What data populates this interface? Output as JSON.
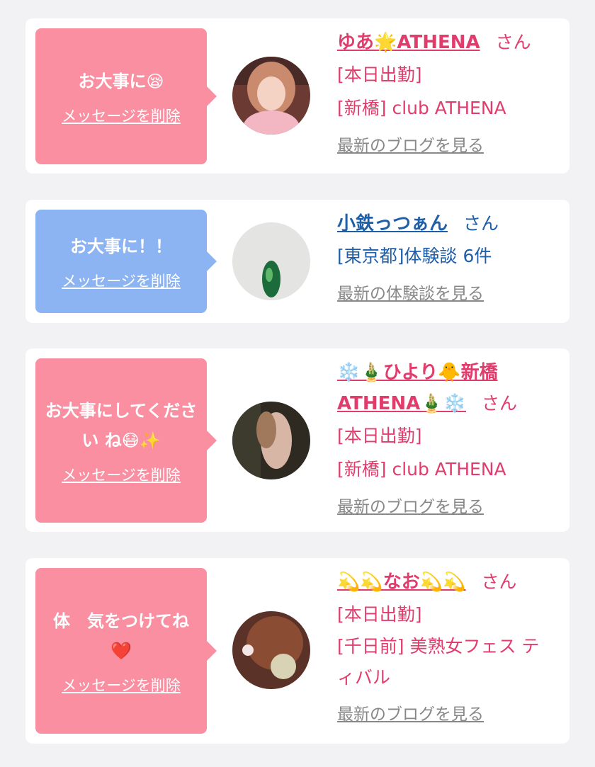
{
  "cards": [
    {
      "message": "お大事に😪",
      "delete_label": "メッセージを削除",
      "name": "ゆあ🌟ATHENA",
      "honorific": "さん",
      "lines": [
        "[本日出勤]",
        "[新橋] club ATHENA"
      ],
      "link": "最新のブログを見る",
      "theme": "#f98fa1"
    },
    {
      "message": "お大事に！！",
      "delete_label": "メッセージを削除",
      "name": "小鉄っつぁん",
      "honorific": "さん",
      "lines": [
        "[東京都]体験談 6件"
      ],
      "link": "最新の体験談を見る",
      "theme": "#8cb3f2"
    },
    {
      "message": "お大事にしてください ね😷✨",
      "delete_label": "メッセージを削除",
      "name": "❄️🎍ひより🐥新橋 ATHENA🎍❄️",
      "honorific": "さん",
      "lines": [
        "[本日出勤]",
        "[新橋] club ATHENA"
      ],
      "link": "最新のブログを見る",
      "theme": "#f98fa1"
    },
    {
      "message": "体　気をつけてね ❤️",
      "delete_label": "メッセージを削除",
      "name": "💫💫なお💫💫",
      "honorific": "さん",
      "lines": [
        "[本日出勤]",
        "[千日前] 美熟女フェス ティバル"
      ],
      "link": "最新のブログを見る",
      "theme": "#f98fa1"
    }
  ]
}
